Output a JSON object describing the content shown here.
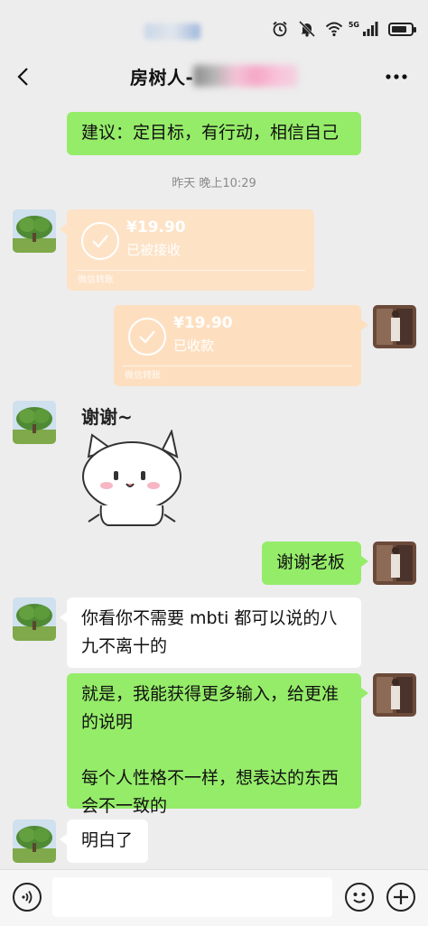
{
  "status_bar": {
    "network": "5G",
    "icons": [
      "alarm-icon",
      "mute-icon",
      "wifi-icon",
      "signal-icon",
      "battery-icon"
    ],
    "battery_level": 0.8
  },
  "header": {
    "title": "房树人-",
    "back_icon": "chevron-left-icon",
    "more_icon": "more-dots-icon"
  },
  "chat": {
    "top_message": "建议：定目标，有行动，相信自己",
    "timestamp": "昨天 晚上10:29",
    "transfer_received": {
      "amount": "¥19.90",
      "status": "已被接收",
      "footer": "微信转账"
    },
    "transfer_collected": {
      "amount": "¥19.90",
      "status": "已收款",
      "footer": "微信转账"
    },
    "sticker_text": "谢谢~",
    "thanks_message": "谢谢老板",
    "reply_message": "你看你不需要 mbti 都可以说的八九不离十的",
    "long_message": {
      "para1": "就是，我能获得更多输入，给更准的说明",
      "para2": "每个人性格不一样，想表达的东西会不一致的"
    },
    "understood_message": "明白了"
  },
  "input_bar": {
    "voice_icon": "voice-icon",
    "emoji_icon": "emoji-icon",
    "plus_icon": "plus-icon"
  },
  "colors": {
    "background": "#ededed",
    "bubble_green": "#95ec69",
    "bubble_white": "#ffffff",
    "transfer": "#fde2c6",
    "timestamp": "#8a8a8a"
  }
}
